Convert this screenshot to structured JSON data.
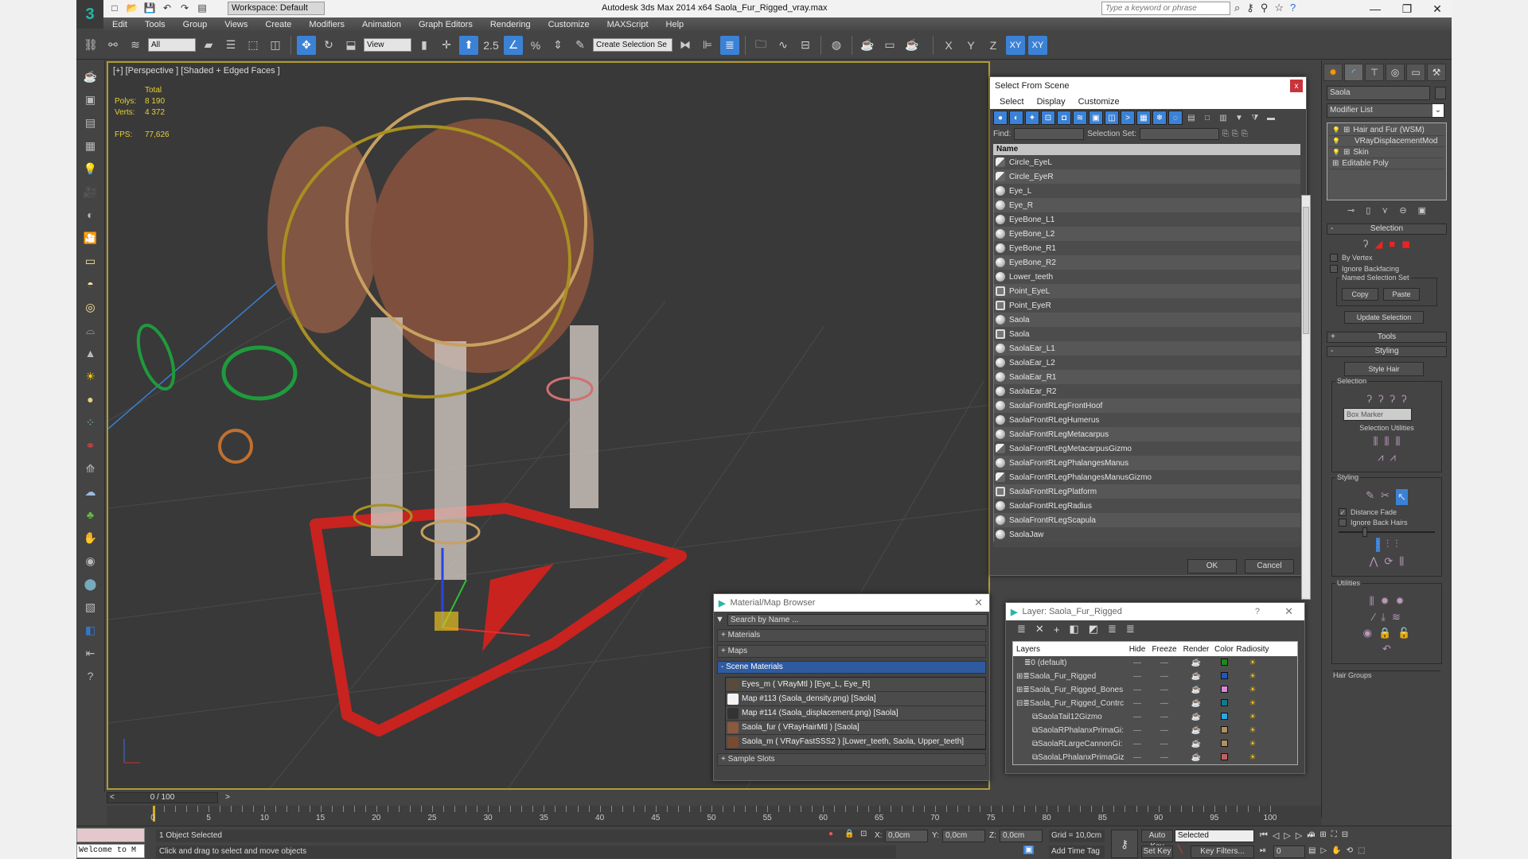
{
  "app": {
    "title": "Autodesk 3ds Max  2014 x64     Saola_Fur_Rigged_vray.max",
    "logo": "3",
    "workspace": "Workspace: Default",
    "search_placeholder": "Type a keyword or phrase",
    "window_controls": {
      "minimize": "—",
      "maximize": "❐",
      "close": "✕"
    }
  },
  "menu": [
    "Edit",
    "Tools",
    "Group",
    "Views",
    "Create",
    "Modifiers",
    "Animation",
    "Graph Editors",
    "Rendering",
    "Customize",
    "MAXScript",
    "Help"
  ],
  "toolbar": {
    "filter_select": "All",
    "ref_coord_select": "View",
    "snap_angle_label": "2.5",
    "named_selection_placeholder": "Create Selection Se",
    "axis_buttons": [
      "X",
      "Y",
      "Z",
      "XY",
      "XY"
    ]
  },
  "viewport": {
    "label": "[+] [Perspective ] [Shaded + Edged Faces ]",
    "stats": {
      "header": "Total",
      "polys_label": "Polys:",
      "polys": "8 190",
      "verts_label": "Verts:",
      "verts": "4 372",
      "fps_label": "FPS:",
      "fps": "77,626"
    }
  },
  "select_from_scene": {
    "title": "Select From Scene",
    "close": "x",
    "menu": [
      "Select",
      "Display",
      "Customize"
    ],
    "find_label": "Find:",
    "selection_set_label": "Selection Set:",
    "column_name": "Name",
    "items": [
      {
        "name": "Circle_EyeL",
        "type": "shape"
      },
      {
        "name": "Circle_EyeR",
        "type": "shape"
      },
      {
        "name": "Eye_L",
        "type": "geometry"
      },
      {
        "name": "Eye_R",
        "type": "geometry"
      },
      {
        "name": "EyeBone_L1",
        "type": "geometry"
      },
      {
        "name": "EyeBone_L2",
        "type": "geometry"
      },
      {
        "name": "EyeBone_R1",
        "type": "geometry"
      },
      {
        "name": "EyeBone_R2",
        "type": "geometry"
      },
      {
        "name": "Lower_teeth",
        "type": "geometry"
      },
      {
        "name": "Point_EyeL",
        "type": "helper"
      },
      {
        "name": "Point_EyeR",
        "type": "helper"
      },
      {
        "name": "Saola",
        "type": "geometry"
      },
      {
        "name": "Saola",
        "type": "helper"
      },
      {
        "name": "SaolaEar_L1",
        "type": "geometry"
      },
      {
        "name": "SaolaEar_L2",
        "type": "geometry"
      },
      {
        "name": "SaolaEar_R1",
        "type": "geometry"
      },
      {
        "name": "SaolaEar_R2",
        "type": "geometry"
      },
      {
        "name": "SaolaFrontRLegFrontHoof",
        "type": "geometry"
      },
      {
        "name": "SaolaFrontRLegHumerus",
        "type": "geometry"
      },
      {
        "name": "SaolaFrontRLegMetacarpus",
        "type": "geometry"
      },
      {
        "name": "SaolaFrontRLegMetacarpusGizmo",
        "type": "shape"
      },
      {
        "name": "SaolaFrontRLegPhalangesManus",
        "type": "geometry"
      },
      {
        "name": "SaolaFrontRLegPhalangesManusGizmo",
        "type": "shape"
      },
      {
        "name": "SaolaFrontRLegPlatform",
        "type": "helper"
      },
      {
        "name": "SaolaFrontRLegRadius",
        "type": "geometry"
      },
      {
        "name": "SaolaFrontRLegScapula",
        "type": "geometry"
      },
      {
        "name": "SaolaJaw",
        "type": "geometry"
      }
    ],
    "ok": "OK",
    "cancel": "Cancel"
  },
  "material_browser": {
    "title": "Material/Map Browser",
    "close": "✕",
    "search_placeholder": "Search by Name ...",
    "sections": [
      "+ Materials",
      "+ Maps",
      "- Scene Materials",
      "+ Sample Slots"
    ],
    "scene_materials": [
      {
        "label": "Eyes_m  ( VRayMtl ) [Eye_L, Eye_R]",
        "color": "#5a4a3a"
      },
      {
        "label": "Map #113 (Saola_density.png) [Saola]",
        "color": "#f4f4f4"
      },
      {
        "label": "Map #114 (Saola_displacement.png) [Saola]",
        "color": "#333333"
      },
      {
        "label": "Saola_fur  ( VRayHairMtl ) [Saola]",
        "color": "#8a5a40"
      },
      {
        "label": "Saola_m  ( VRayFastSSS2 ) [Lower_teeth, Saola, Upper_teeth]",
        "color": "#7a4a30"
      }
    ]
  },
  "layer_dialog": {
    "title": "Layer: Saola_Fur_Rigged",
    "help": "?",
    "close": "✕",
    "columns": [
      "Layers",
      "Hide",
      "Freeze",
      "Render",
      "Color",
      "Radiosity"
    ],
    "rows": [
      {
        "name": "0 (default)",
        "color": "#1a8a1a",
        "indent": 1
      },
      {
        "name": "Saola_Fur_Rigged",
        "color": "#2255bb",
        "indent": 0,
        "expand": "+"
      },
      {
        "name": "Saola_Fur_Rigged_Bones",
        "color": "#d88ad8",
        "indent": 0,
        "expand": "+"
      },
      {
        "name": "Saola_Fur_Rigged_Contrc",
        "color": "#157a8a",
        "indent": 0,
        "expand": "-"
      },
      {
        "name": "SaolaTail12Gizmo",
        "color": "#2aa8e0",
        "indent": 2
      },
      {
        "name": "SaolaRPhalanxPrimaGi:",
        "color": "#b09060",
        "indent": 2
      },
      {
        "name": "SaolaRLargeCannonGi:",
        "color": "#b09060",
        "indent": 2
      },
      {
        "name": "SaolaLPhalanxPrimaGiz",
        "color": "#c06060",
        "indent": 2
      }
    ]
  },
  "command_panel": {
    "object_name": "Saola",
    "modifier_list": "Modifier List",
    "modifiers": [
      {
        "name": "Hair and Fur (WSM)",
        "expand": true,
        "bulb": true
      },
      {
        "name": "VRayDisplacementMod",
        "expand": false,
        "bulb": true
      },
      {
        "name": "Skin",
        "expand": true,
        "bulb": true
      },
      {
        "name": "Editable Poly",
        "expand": true,
        "bulb": false
      }
    ],
    "selection_rollout": "Selection",
    "by_vertex": "By Vertex",
    "ignore_backfacing": "Ignore Backfacing",
    "named_selection_set": "Named Selection Set",
    "copy": "Copy",
    "paste": "Paste",
    "update_selection": "Update Selection",
    "tools_rollout": "Tools",
    "styling_rollout": "Styling",
    "style_hair": "Style Hair",
    "selection_group": "Selection",
    "box_marker": "Box Marker",
    "selection_utilities": "Selection Utilities",
    "styling_group": "Styling",
    "distance_fade": "Distance Fade",
    "distance_fade_checked": true,
    "ignore_back_hairs": "Ignore Back Hairs",
    "ignore_back_hairs_checked": false,
    "utilities_group": "Utilities",
    "hair_groups": "Hair Groups"
  },
  "timeline": {
    "frame": "0 / 100",
    "ticks": [
      0,
      5,
      10,
      15,
      20,
      25,
      30,
      35,
      40,
      45,
      50,
      55,
      60,
      65,
      70,
      75,
      80,
      85,
      90,
      95,
      100
    ]
  },
  "status": {
    "listener_text": "Welcome to M",
    "selected": "1 Object Selected",
    "prompt": "Click and drag to select and move objects",
    "x_label": "X:",
    "x": "0,0cm",
    "y_label": "Y:",
    "y": "0,0cm",
    "z_label": "Z:",
    "z": "0,0cm",
    "grid": "Grid = 10,0cm",
    "add_time_tag": "Add Time Tag",
    "auto_key": "Auto Key",
    "set_key": "Set Key",
    "key_mode": "Selected",
    "key_filters": "Key Filters...",
    "current_frame": "0"
  }
}
